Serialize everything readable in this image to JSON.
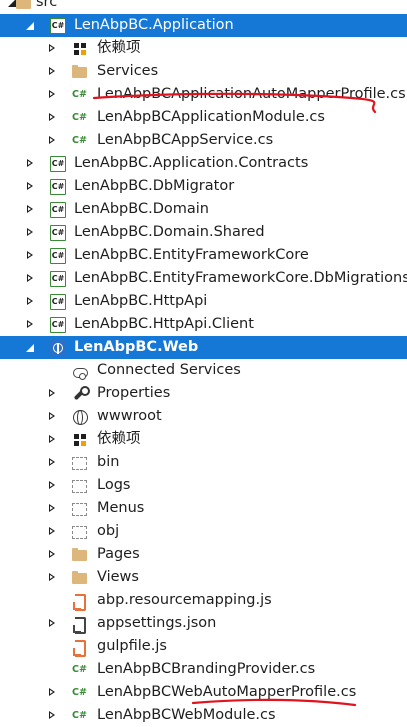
{
  "tree": [
    {
      "label": "src",
      "icon": "folder-icon",
      "iconClass": "ic-folder",
      "arrow": "expanded",
      "level": 0,
      "partial": true
    },
    {
      "label": "LenAbpBC.Application",
      "icon": "csharp-project-icon",
      "iconClass": "ic-cs",
      "arrow": "expanded",
      "level": 1,
      "selected": true
    },
    {
      "label": "依赖项",
      "icon": "dependencies-icon",
      "iconClass": "ic-deps",
      "arrow": "collapsed",
      "level": 2
    },
    {
      "label": "Services",
      "icon": "folder-icon",
      "iconClass": "ic-folder",
      "arrow": "collapsed",
      "level": 2
    },
    {
      "label": "LenAbpBCApplicationAutoMapperProfile.cs",
      "icon": "csharp-file-icon",
      "iconClass": "ic-csfile",
      "arrow": "collapsed",
      "level": 2
    },
    {
      "label": "LenAbpBCApplicationModule.cs",
      "icon": "csharp-file-icon",
      "iconClass": "ic-csfile",
      "arrow": "collapsed",
      "level": 2
    },
    {
      "label": "LenAbpBCAppService.cs",
      "icon": "csharp-file-icon",
      "iconClass": "ic-csfile",
      "arrow": "collapsed",
      "level": 2
    },
    {
      "label": "LenAbpBC.Application.Contracts",
      "icon": "csharp-project-icon",
      "iconClass": "ic-cs",
      "arrow": "collapsed",
      "level": 1
    },
    {
      "label": "LenAbpBC.DbMigrator",
      "icon": "csharp-project-icon",
      "iconClass": "ic-cs",
      "arrow": "collapsed",
      "level": 1
    },
    {
      "label": "LenAbpBC.Domain",
      "icon": "csharp-project-icon",
      "iconClass": "ic-cs",
      "arrow": "collapsed",
      "level": 1
    },
    {
      "label": "LenAbpBC.Domain.Shared",
      "icon": "csharp-project-icon",
      "iconClass": "ic-cs",
      "arrow": "collapsed",
      "level": 1
    },
    {
      "label": "LenAbpBC.EntityFrameworkCore",
      "icon": "csharp-project-icon",
      "iconClass": "ic-cs",
      "arrow": "collapsed",
      "level": 1
    },
    {
      "label": "LenAbpBC.EntityFrameworkCore.DbMigrations",
      "icon": "csharp-project-icon",
      "iconClass": "ic-cs",
      "arrow": "collapsed",
      "level": 1
    },
    {
      "label": "LenAbpBC.HttpApi",
      "icon": "csharp-project-icon",
      "iconClass": "ic-cs",
      "arrow": "collapsed",
      "level": 1
    },
    {
      "label": "LenAbpBC.HttpApi.Client",
      "icon": "csharp-project-icon",
      "iconClass": "ic-cs",
      "arrow": "collapsed",
      "level": 1
    },
    {
      "label": "LenAbpBC.Web",
      "icon": "web-project-icon",
      "iconClass": "ic-web",
      "arrow": "expanded",
      "level": 1,
      "selected": true,
      "bold": true
    },
    {
      "label": "Connected Services",
      "icon": "connected-services-icon",
      "iconClass": "ic-cloud",
      "arrow": "none",
      "level": 2
    },
    {
      "label": "Properties",
      "icon": "wrench-icon",
      "iconClass": "ic-wrench",
      "arrow": "collapsed",
      "level": 2
    },
    {
      "label": "wwwroot",
      "icon": "globe-icon",
      "iconClass": "ic-globe",
      "arrow": "collapsed",
      "level": 2
    },
    {
      "label": "依赖项",
      "icon": "dependencies-icon",
      "iconClass": "ic-deps",
      "arrow": "collapsed",
      "level": 2
    },
    {
      "label": "bin",
      "icon": "dashed-folder-icon",
      "iconClass": "ic-dashfolder",
      "arrow": "collapsed",
      "level": 2
    },
    {
      "label": "Logs",
      "icon": "dashed-folder-icon",
      "iconClass": "ic-dashfolder",
      "arrow": "collapsed",
      "level": 2
    },
    {
      "label": "Menus",
      "icon": "dashed-folder-icon",
      "iconClass": "ic-dashfolder",
      "arrow": "collapsed",
      "level": 2
    },
    {
      "label": "obj",
      "icon": "dashed-folder-icon",
      "iconClass": "ic-dashfolder",
      "arrow": "collapsed",
      "level": 2
    },
    {
      "label": "Pages",
      "icon": "folder-icon",
      "iconClass": "ic-folder",
      "arrow": "collapsed",
      "level": 2
    },
    {
      "label": "Views",
      "icon": "folder-icon",
      "iconClass": "ic-folder",
      "arrow": "collapsed",
      "level": 2
    },
    {
      "label": "abp.resourcemapping.js",
      "icon": "js-file-icon",
      "iconClass": "ic-js",
      "arrow": "none",
      "level": 2
    },
    {
      "label": "appsettings.json",
      "icon": "json-file-icon",
      "iconClass": "ic-json",
      "arrow": "collapsed",
      "level": 2
    },
    {
      "label": "gulpfile.js",
      "icon": "js-file-icon",
      "iconClass": "ic-js",
      "arrow": "none",
      "level": 2
    },
    {
      "label": "LenAbpBCBrandingProvider.cs",
      "icon": "csharp-file-icon",
      "iconClass": "ic-csfile",
      "arrow": "none",
      "level": 2
    },
    {
      "label": "LenAbpBCWebAutoMapperProfile.cs",
      "icon": "csharp-file-icon",
      "iconClass": "ic-csfile",
      "arrow": "collapsed",
      "level": 2
    },
    {
      "label": "LenAbpBCWebModule.cs",
      "icon": "csharp-file-icon",
      "iconClass": "ic-csfile",
      "arrow": "collapsed",
      "level": 2,
      "partial": true
    }
  ],
  "colors": {
    "selection": "#1577d6",
    "annotation": "#e0141e"
  }
}
